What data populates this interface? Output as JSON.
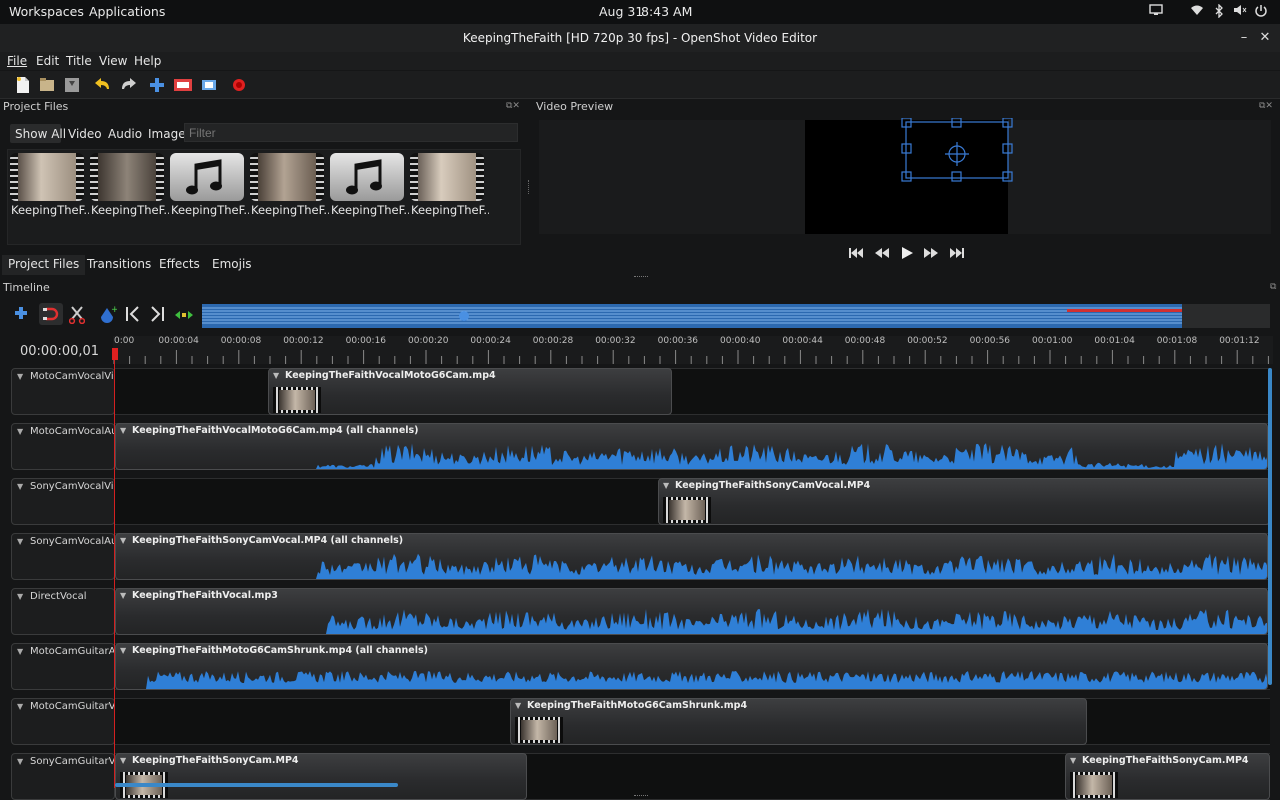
{
  "system_bar": {
    "workspaces": "Workspaces",
    "applications": "Applications",
    "date": "Aug 31",
    "time": "8:43 AM",
    "icons": [
      "screen-icon",
      "wifi-icon",
      "bluetooth-icon",
      "volume-icon",
      "power-icon"
    ]
  },
  "window": {
    "title": "KeepingTheFaith [HD 720p 30 fps] - OpenShot Video Editor"
  },
  "menu": [
    "File",
    "Edit",
    "Title",
    "View",
    "Help"
  ],
  "toolbar_icons": [
    "new-project-icon",
    "open-project-icon",
    "save-project-icon",
    "undo-icon",
    "redo-icon",
    "import-files-icon",
    "choose-profile-icon",
    "fullscreen-icon",
    "export-video-icon"
  ],
  "project_files": {
    "panel_title": "Project Files",
    "filters": [
      "Show All",
      "Video",
      "Audio",
      "Image"
    ],
    "filter_placeholder": "Filter",
    "files": [
      {
        "label": "KeepingTheF...",
        "kind": "video"
      },
      {
        "label": "KeepingTheF...",
        "kind": "video"
      },
      {
        "label": "KeepingTheF...",
        "kind": "audio"
      },
      {
        "label": "KeepingTheF...",
        "kind": "video"
      },
      {
        "label": "KeepingTheF...",
        "kind": "audio"
      },
      {
        "label": "KeepingTheF...",
        "kind": "video"
      }
    ],
    "tabs": [
      "Project Files",
      "Transitions",
      "Effects",
      "Emojis"
    ]
  },
  "video_preview": {
    "panel_title": "Video Preview",
    "controls": [
      "jump-start-icon",
      "rewind-icon",
      "play-icon",
      "fast-forward-icon",
      "jump-end-icon"
    ]
  },
  "timeline": {
    "panel_title": "Timeline",
    "timecode": "00:00:00,01",
    "ruler_labels": [
      "0:00",
      "00:00:04",
      "00:00:08",
      "00:00:12",
      "00:00:16",
      "00:00:20",
      "00:00:24",
      "00:00:28",
      "00:00:32",
      "00:00:36",
      "00:00:40",
      "00:00:44",
      "00:00:48",
      "00:00:52",
      "00:00:56",
      "00:01:00",
      "00:01:04",
      "00:01:08",
      "00:01:12"
    ],
    "tools": [
      "add-track-icon",
      "snap-icon",
      "razor-icon",
      "add-marker-icon",
      "previous-marker-icon",
      "next-marker-icon",
      "center-playhead-icon"
    ],
    "tracks": [
      {
        "name": "MotoCamVocalVideo",
        "clips": [
          {
            "title": "KeepingTheFaithVocalMotoG6Cam.mp4",
            "type": "video"
          }
        ]
      },
      {
        "name": "MotoCamVocalAudio",
        "clips": [
          {
            "title": "KeepingTheFaithVocalMotoG6Cam.mp4 (all channels)",
            "type": "audio"
          }
        ]
      },
      {
        "name": "SonyCamVocalVideo",
        "clips": [
          {
            "title": "KeepingTheFaithSonyCamVocal.MP4",
            "type": "video"
          }
        ]
      },
      {
        "name": "SonyCamVocalAudio",
        "clips": [
          {
            "title": "KeepingTheFaithSonyCamVocal.MP4 (all channels)",
            "type": "audio"
          }
        ]
      },
      {
        "name": "DirectVocal",
        "clips": [
          {
            "title": "KeepingTheFaithVocal.mp3",
            "type": "audio"
          }
        ]
      },
      {
        "name": "MotoCamGuitarAudio",
        "clips": [
          {
            "title": "KeepingTheFaithMotoG6CamShrunk.mp4 (all channels)",
            "type": "audio"
          }
        ]
      },
      {
        "name": "MotoCamGuitarVideo",
        "clips": [
          {
            "title": "KeepingTheFaithMotoG6CamShrunk.mp4",
            "type": "video"
          }
        ]
      },
      {
        "name": "SonyCamGuitarVideo",
        "clips": [
          {
            "title": "KeepingTheFaithSonyCam.MP4",
            "type": "video"
          },
          {
            "title": "KeepingTheFaithSonyCam.MP4",
            "type": "video"
          }
        ]
      }
    ]
  },
  "colors": {
    "accent_blue": "#2f7fd6",
    "playhead_red": "#d32020",
    "background": "#151617"
  }
}
